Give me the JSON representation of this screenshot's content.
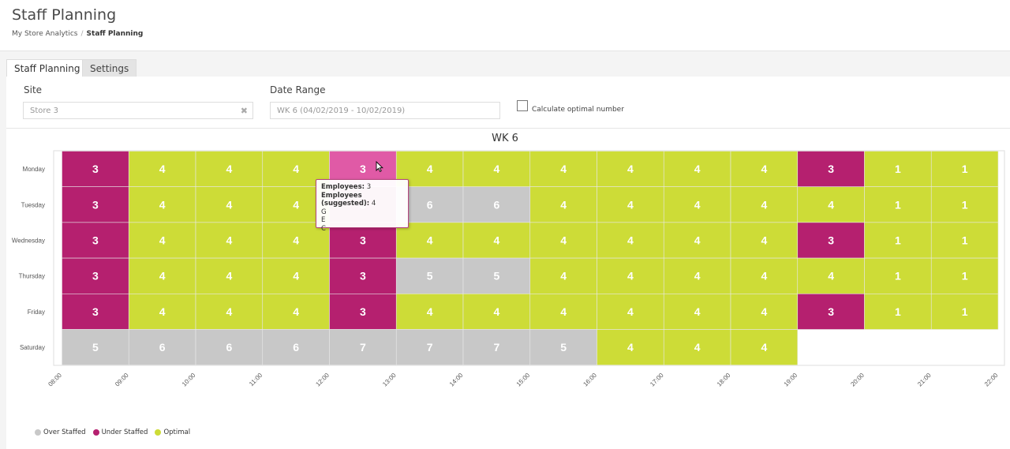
{
  "page": {
    "title": "Staff Planning",
    "breadcrumb": {
      "parent": "My Store Analytics",
      "current": "Staff Planning"
    }
  },
  "tabs": [
    {
      "label": "Staff Planning",
      "active": true
    },
    {
      "label": "Settings",
      "active": false
    }
  ],
  "filters": {
    "site": {
      "label": "Site",
      "value": "Store 3"
    },
    "date_range": {
      "label": "Date Range",
      "value": "WK 6 (04/02/2019 - 10/02/2019)"
    },
    "optimal_checkbox": {
      "label": "Calculate optimal number",
      "checked": false
    }
  },
  "colors": {
    "over": "#c8c8c8",
    "under": "#b5206f",
    "optimal": "#cddc37",
    "hover": "#e05aa6"
  },
  "chart_data": {
    "type": "heatmap",
    "title": "WK 6",
    "x_ticks": [
      "08:00",
      "09:00",
      "10:00",
      "11:00",
      "12:00",
      "13:00",
      "14:00",
      "15:00",
      "16:00",
      "17:00",
      "18:00",
      "19:00",
      "20:00",
      "21:00",
      "22:00"
    ],
    "y_categories": [
      "Monday",
      "Tuesday",
      "Wednesday",
      "Thursday",
      "Friday",
      "Saturday"
    ],
    "legend": [
      {
        "key": "over",
        "label": "Over Staffed"
      },
      {
        "key": "under",
        "label": "Under Staffed"
      },
      {
        "key": "optimal",
        "label": "Optimal"
      }
    ],
    "values": [
      [
        3,
        4,
        4,
        4,
        3,
        4,
        4,
        4,
        4,
        4,
        4,
        3,
        1,
        1
      ],
      [
        3,
        4,
        4,
        4,
        3,
        6,
        6,
        4,
        4,
        4,
        4,
        4,
        1,
        1
      ],
      [
        3,
        4,
        4,
        4,
        3,
        4,
        4,
        4,
        4,
        4,
        4,
        3,
        1,
        1
      ],
      [
        3,
        4,
        4,
        4,
        3,
        5,
        5,
        4,
        4,
        4,
        4,
        4,
        1,
        1
      ],
      [
        3,
        4,
        4,
        4,
        3,
        4,
        4,
        4,
        4,
        4,
        4,
        3,
        1,
        1
      ],
      [
        5,
        6,
        6,
        6,
        7,
        7,
        7,
        5,
        4,
        4,
        4,
        null,
        null,
        null
      ]
    ],
    "status": [
      [
        "under",
        "optimal",
        "optimal",
        "optimal",
        "under",
        "optimal",
        "optimal",
        "optimal",
        "optimal",
        "optimal",
        "optimal",
        "under",
        "optimal",
        "optimal"
      ],
      [
        "under",
        "optimal",
        "optimal",
        "optimal",
        "under",
        "over",
        "over",
        "optimal",
        "optimal",
        "optimal",
        "optimal",
        "optimal",
        "optimal",
        "optimal"
      ],
      [
        "under",
        "optimal",
        "optimal",
        "optimal",
        "under",
        "optimal",
        "optimal",
        "optimal",
        "optimal",
        "optimal",
        "optimal",
        "under",
        "optimal",
        "optimal"
      ],
      [
        "under",
        "optimal",
        "optimal",
        "optimal",
        "under",
        "over",
        "over",
        "optimal",
        "optimal",
        "optimal",
        "optimal",
        "optimal",
        "optimal",
        "optimal"
      ],
      [
        "under",
        "optimal",
        "optimal",
        "optimal",
        "under",
        "optimal",
        "optimal",
        "optimal",
        "optimal",
        "optimal",
        "optimal",
        "under",
        "optimal",
        "optimal"
      ],
      [
        "over",
        "over",
        "over",
        "over",
        "over",
        "over",
        "over",
        "over",
        "optimal",
        "optimal",
        "optimal",
        null,
        null,
        null
      ]
    ],
    "hovered_cell": {
      "day": "Monday",
      "hour": "12:00"
    }
  },
  "tooltip": {
    "employees_label": "Employees:",
    "employees_value": "3",
    "suggested_label": "Employees (suggested):",
    "suggested_value": "4",
    "lines": [
      "G",
      "E",
      "C"
    ]
  }
}
